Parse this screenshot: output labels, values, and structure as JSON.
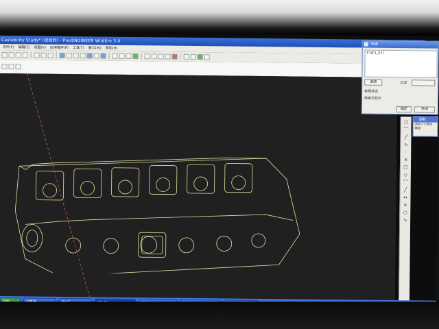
{
  "window": {
    "title": "Castability Study* (活动的) - Pro/ENGINEER Wildfire 5.0"
  },
  "menu": [
    "文件(F)",
    "编辑(E)",
    "视图(V)",
    "应用程序(P)",
    "工具(T)",
    "窗口(W)",
    "帮助(H)"
  ],
  "dialog": {
    "title": "依据",
    "list_item": "F1(F1_E1)",
    "select_button": "选取",
    "filter_label": "过滤",
    "ok_button": "确定",
    "options_label": "参照状态",
    "status_text": "两者均显示",
    "close_button": "关闭"
  },
  "side_panel": {
    "title": "选取",
    "line1": "选取1个项目",
    "line2": "确定"
  },
  "taskbar": {
    "items": [
      "开始",
      "计算器",
      "Pro/E",
      "Wildfire",
      "AVB",
      "000000FA",
      "选择"
    ]
  },
  "colors": {
    "titlebar": "#1f4fb8",
    "taskbar": "#2455c4",
    "wireframe": "#e8e3a4",
    "background": "#202020"
  }
}
